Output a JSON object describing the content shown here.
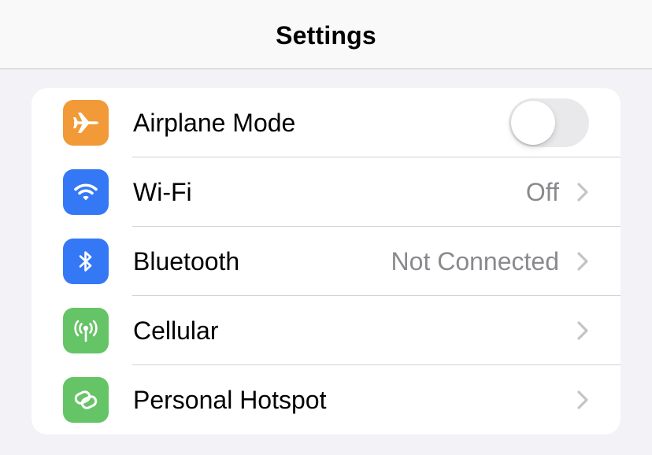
{
  "navbar": {
    "title": "Settings"
  },
  "rows": [
    {
      "label": "Airplane Mode",
      "icon": "airplane-icon",
      "icon_color": "#f19a37",
      "control": "toggle",
      "toggle_on": false
    },
    {
      "label": "Wi-Fi",
      "icon": "wifi-icon",
      "icon_color": "#3478f6",
      "value": "Off",
      "control": "chevron"
    },
    {
      "label": "Bluetooth",
      "icon": "bluetooth-icon",
      "icon_color": "#3478f6",
      "value": "Not Connected",
      "control": "chevron"
    },
    {
      "label": "Cellular",
      "icon": "cellular-antenna-icon",
      "icon_color": "#65c466",
      "control": "chevron"
    },
    {
      "label": "Personal Hotspot",
      "icon": "personal-hotspot-icon",
      "icon_color": "#65c466",
      "control": "chevron"
    }
  ]
}
